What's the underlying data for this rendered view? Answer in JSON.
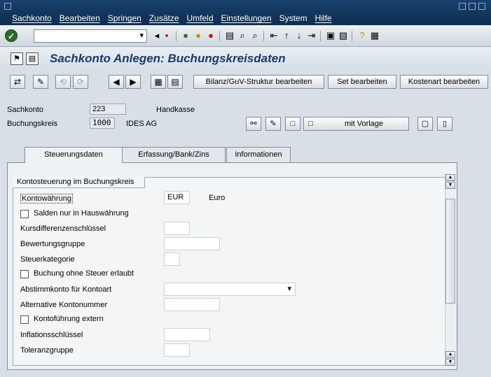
{
  "menu": [
    "Sachkonto",
    "Bearbeiten",
    "Springen",
    "Zusätze",
    "Umfeld",
    "Einstellungen",
    "System",
    "Hilfe"
  ],
  "page_title": "Sachkonto Anlegen: Buchungskreisdaten",
  "app_buttons": {
    "bilanz": "Bilanz/GuV-Struktur bearbeiten",
    "set": "Set bearbeiten",
    "kostenart": "Kostenart bearbeiten"
  },
  "header": {
    "sachkonto_label": "Sachkonto",
    "sachkonto_value": "223",
    "sachkonto_text": "Handkasse",
    "bukrs_label": "Buchungskreis",
    "bukrs_value": "1000",
    "bukrs_text": "IDES AG",
    "mit_vorlage": "mit Vorlage"
  },
  "tabs": [
    "Steuerungsdaten",
    "Erfassung/Bank/Zins",
    "Informationen"
  ],
  "group_title": "Kontosteuerung im Buchungskreis",
  "fields": {
    "kontowaehrung_label": "Kontowährung",
    "kontowaehrung_value": "EUR",
    "kontowaehrung_text": "Euro",
    "salden_label": "Salden nur in Hauswährung",
    "kursdiff_label": "Kursdifferenzenschlüssel",
    "bewertung_label": "Bewertungsgruppe",
    "steuerkat_label": "Steuerkategorie",
    "ohne_steuer_label": "Buchung ohne Steuer erlaubt",
    "abstimm_label": "Abstimmkonto für Kontoart",
    "alt_konto_label": "Alternative Kontonummer",
    "extern_label": "Kontoführung extern",
    "inflation_label": "Inflationsschlüssel",
    "toleranz_label": "Toleranzgruppe"
  }
}
